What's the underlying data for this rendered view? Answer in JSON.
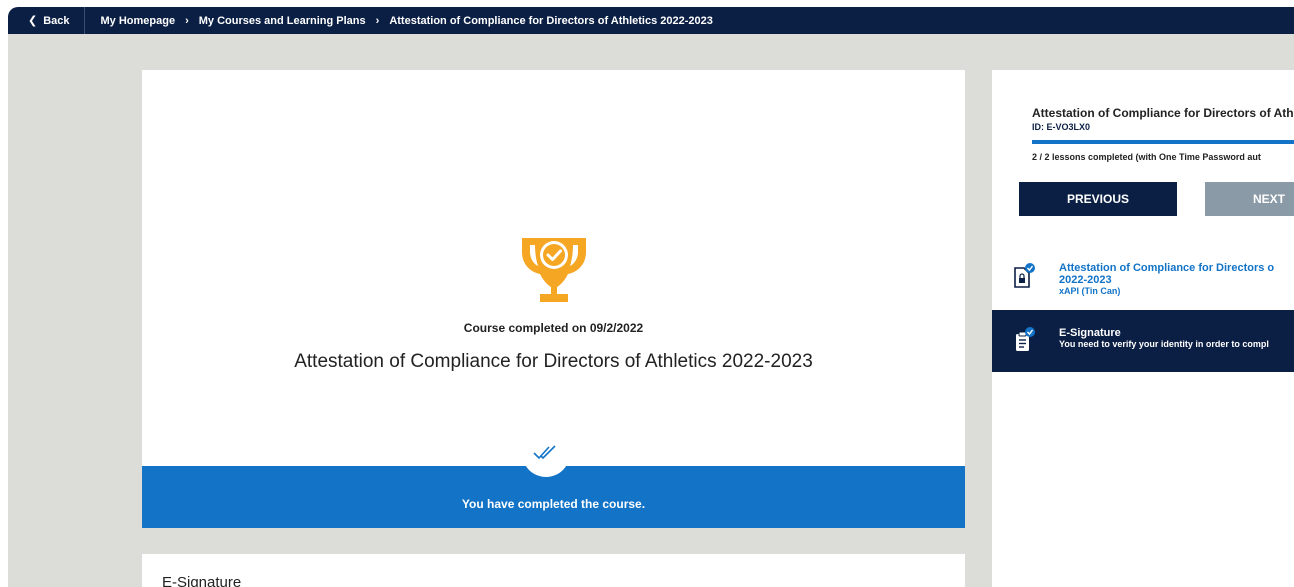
{
  "topbar": {
    "back_label": "Back",
    "breadcrumbs": [
      "My Homepage",
      "My Courses and Learning Plans",
      "Attestation of Compliance for Directors of Athletics 2022-2023"
    ]
  },
  "main": {
    "completed_on": "Course completed on 09/2/2022",
    "course_title": "Attestation of Compliance for Directors of Athletics 2022-2023",
    "completed_message": "You have completed the course.",
    "esignature_label": "E-Signature"
  },
  "side": {
    "title": "Attestation of Compliance for Directors of Ath",
    "id_label": "ID: E-VO3LX0",
    "progress_fraction": 1.0,
    "lessons_completed": "2 / 2 lessons completed (with One Time Password aut",
    "previous_label": "PREVIOUS",
    "next_label": "NEXT",
    "lessons": [
      {
        "title_line1": "Attestation of Compliance for Directors o",
        "title_line2": "2022-2023",
        "type": "xAPI (Tin Can)",
        "icon": "document-lock-icon"
      },
      {
        "title": "E-Signature",
        "subtitle": "You need to verify your identity in order to compl",
        "icon": "clipboard-icon"
      }
    ]
  },
  "colors": {
    "navy": "#0b1f45",
    "brand_blue": "#1273c7",
    "trophy_gold": "#f5a623",
    "disabled_gray": "#8a9aa6"
  }
}
